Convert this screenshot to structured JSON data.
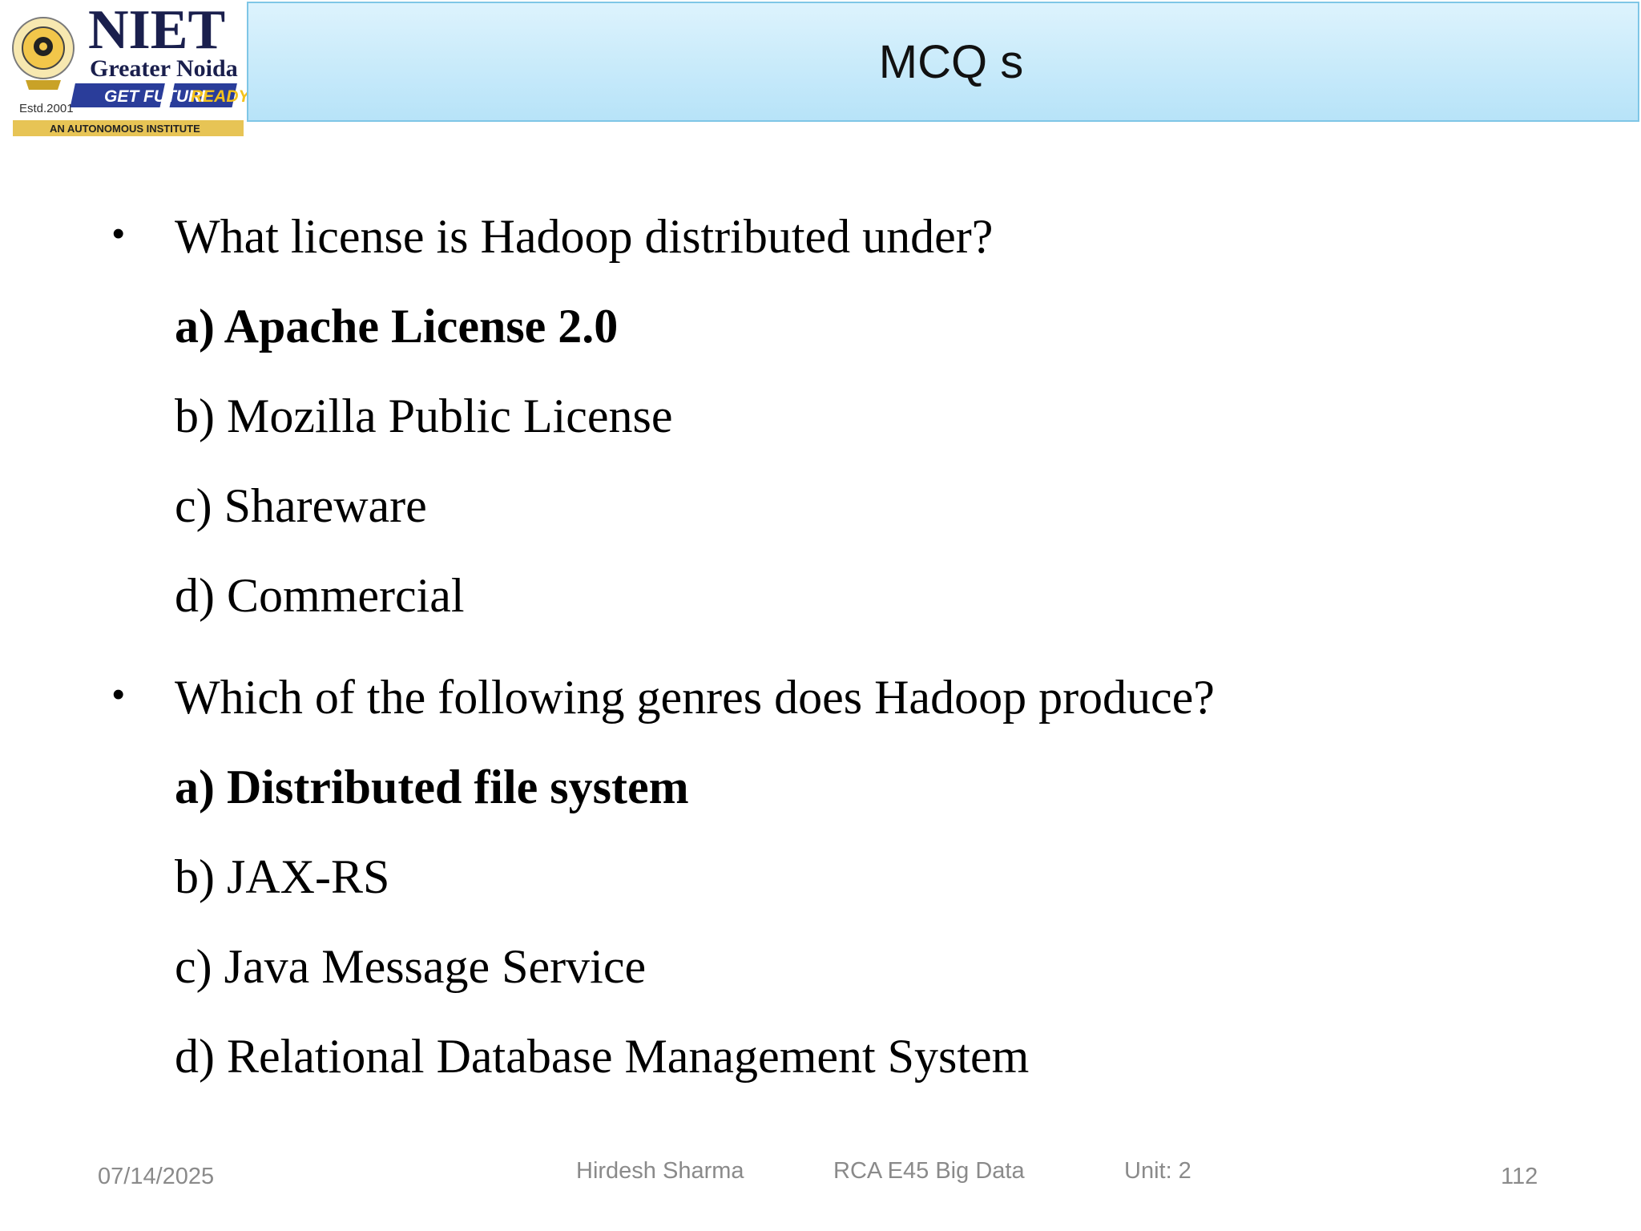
{
  "logo": {
    "name": "NIET",
    "location": "Greater Noida",
    "tagline_a": "GET FUTURE",
    "tagline_b": "READY",
    "established": "Estd.2001",
    "banner": "AN AUTONOMOUS INSTITUTE"
  },
  "header": {
    "title": "MCQ s"
  },
  "questions": [
    {
      "text": "What license is Hadoop distributed under?",
      "options": [
        {
          "text": "a) Apache License 2.0",
          "bold": true
        },
        {
          "text": "b) Mozilla Public License",
          "bold": false
        },
        {
          "text": "c) Shareware",
          "bold": false
        },
        {
          "text": "d) Commercial",
          "bold": false
        }
      ]
    },
    {
      "text": "Which of the following genres does Hadoop produce?",
      "options": [
        {
          "text": "a) Distributed file system",
          "bold": true
        },
        {
          "text": "b) JAX-RS",
          "bold": false
        },
        {
          "text": "c) Java Message Service",
          "bold": false
        },
        {
          "text": "d) Relational Database Management System",
          "bold": false
        }
      ]
    }
  ],
  "footer": {
    "date": "07/14/2025",
    "author": "Hirdesh Sharma",
    "course": "RCA E45 Big Data",
    "unit": "Unit: 2",
    "page": "112"
  }
}
